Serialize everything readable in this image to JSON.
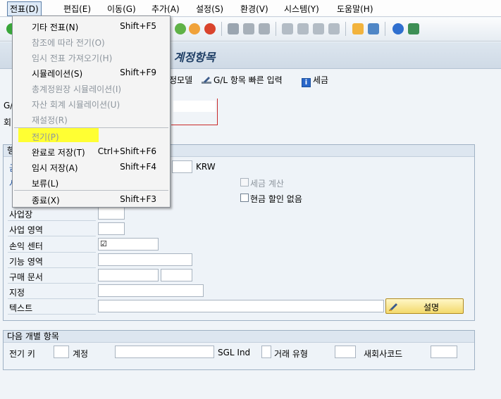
{
  "menubar": {
    "items": [
      "전표(D)",
      "편집(E)",
      "이동(G)",
      "추가(A)",
      "설정(S)",
      "환경(V)",
      "시스템(Y)",
      "도움말(H)"
    ]
  },
  "titlebar": {
    "title": "/L 계정항목"
  },
  "apptoolbar": {
    "fragment_label": "정모델",
    "quick_entry_label": "G/L 항목 빠른 입력",
    "tax_label": "세금"
  },
  "header": {
    "label1": "G/",
    "label2": "회",
    "label3": "행"
  },
  "amount": {
    "currency": "KRW"
  },
  "checks": {
    "tax_calc": "세금 계산",
    "no_cash_discount": "현금 할인 없음"
  },
  "rows": {
    "business_place": "사업장",
    "business_area": "사업 영역",
    "profit_center": "손익 센터",
    "functional_area": "기능 영역",
    "purchase_document": "구매 문서",
    "assignment": "지정",
    "text": "텍스트"
  },
  "description_button": "설명",
  "next_item": {
    "group_title": "다음 개별 항목",
    "posting_key": "전기 키",
    "account": "계정",
    "sgl_ind": "SGL Ind",
    "transaction_type": "거래 유형",
    "new_company_code": "새회사코드"
  },
  "dropdown": {
    "items": [
      {
        "label": "기타 전표(N)",
        "shortcut": "Shift+F5",
        "enabled": true
      },
      {
        "label": "참조에 따라 전기(O)",
        "shortcut": "",
        "enabled": false
      },
      {
        "label": "임시 전표 가져오기(H)",
        "shortcut": "",
        "enabled": false
      },
      {
        "label": "시뮬레이션(S)",
        "shortcut": "Shift+F9",
        "enabled": true
      },
      {
        "label": "총계정원장 시뮬레이션(I)",
        "shortcut": "",
        "enabled": false
      },
      {
        "label": "자산 회계 시뮬레이션(U)",
        "shortcut": "",
        "enabled": false
      },
      {
        "label": "재설정(R)",
        "shortcut": "",
        "enabled": false
      },
      {
        "label": "전기(P)",
        "shortcut": "",
        "enabled": false
      },
      {
        "label": "완료로 저장(T)",
        "shortcut": "Ctrl+Shift+F6",
        "enabled": true
      },
      {
        "label": "임시 저장(A)",
        "shortcut": "Shift+F4",
        "enabled": true
      },
      {
        "label": "보류(L)",
        "shortcut": "",
        "enabled": true
      },
      {
        "label": "종료(X)",
        "shortcut": "Shift+F3",
        "enabled": true
      }
    ]
  },
  "colors": {
    "highlight": "#ffff33",
    "title_text": "#1f3f66"
  }
}
